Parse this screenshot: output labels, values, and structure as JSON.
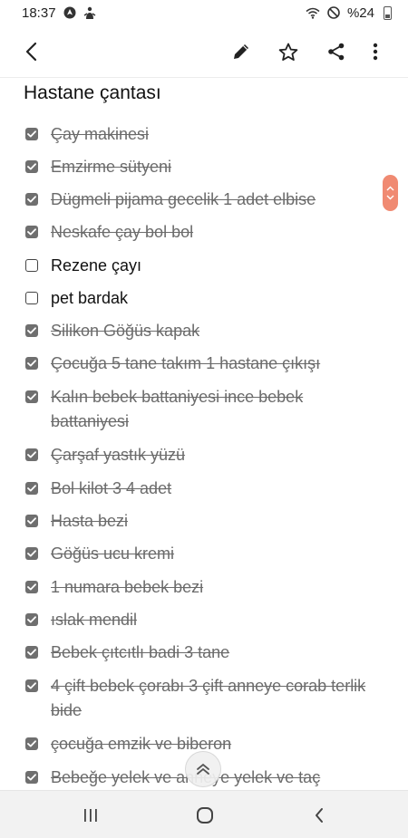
{
  "status_bar": {
    "time": "18:37",
    "battery_text": "%24",
    "icons": [
      "navigation-icon",
      "notification-icon",
      "wifi-icon",
      "do-not-disturb-icon",
      "battery-icon"
    ]
  },
  "toolbar": {
    "icons": [
      "back-arrow-icon",
      "pencil-icon",
      "star-icon",
      "share-icon",
      "more-vert-icon"
    ]
  },
  "note": {
    "title": "Hastane çantası",
    "items": [
      {
        "text": "Çay makinesi",
        "checked": true
      },
      {
        "text": "Emzirme sütyeni",
        "checked": true
      },
      {
        "text": "Dügmeli pijama gecelik 1 adet elbise",
        "checked": true
      },
      {
        "text": "Neskafe çay bol bol",
        "checked": true
      },
      {
        "text": "Rezene çayı",
        "checked": false
      },
      {
        "text": " pet bardak",
        "checked": false
      },
      {
        "text": " Silikon Göğüs kapak",
        "checked": true
      },
      {
        "text": "Çocuğa 5 tane takım 1 hastane çıkışı",
        "checked": true
      },
      {
        "text": "Kalın bebek battaniyesi ince bebek battaniyesi",
        "checked": true
      },
      {
        "text": "Çarşaf yastık yüzü",
        "checked": true
      },
      {
        "text": "Bol kilot 3 4 adet",
        "checked": true
      },
      {
        "text": "Hasta bezi",
        "checked": true
      },
      {
        "text": "Göğüs ucu kremi",
        "checked": true
      },
      {
        "text": "1 numara bebek bezi",
        "checked": true
      },
      {
        "text": " ıslak mendil",
        "checked": true
      },
      {
        "text": "Bebek çıtcıtlı badi 3 tane",
        "checked": true
      },
      {
        "text": "4 çift bebek çorabı 3 çift anneye corab terlik bide",
        "checked": true
      },
      {
        "text": "çocuğa emzik ve biberon",
        "checked": true
      },
      {
        "text": "Bebeğe yelek ve anneye yelek ve taç",
        "checked": true
      }
    ]
  },
  "accent_color": "#f08a72",
  "nav_bar": {
    "icons": [
      "recent-apps-icon",
      "home-icon",
      "back-icon"
    ]
  }
}
